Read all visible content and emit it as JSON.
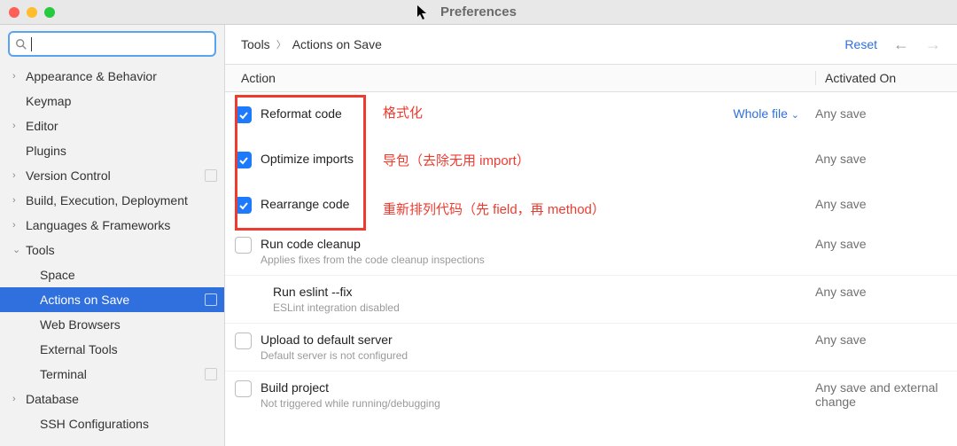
{
  "window": {
    "title": "Preferences"
  },
  "search": {
    "placeholder": ""
  },
  "sidebar": {
    "items": [
      {
        "label": "Appearance & Behavior",
        "expandable": true
      },
      {
        "label": "Keymap"
      },
      {
        "label": "Editor",
        "expandable": true
      },
      {
        "label": "Plugins"
      },
      {
        "label": "Version Control",
        "expandable": true,
        "badge": true
      },
      {
        "label": "Build, Execution, Deployment",
        "expandable": true
      },
      {
        "label": "Languages & Frameworks",
        "expandable": true
      },
      {
        "label": "Tools",
        "expandable": true,
        "open": true,
        "children": [
          {
            "label": "Space"
          },
          {
            "label": "Actions on Save",
            "selected": true,
            "badge": true
          },
          {
            "label": "Web Browsers"
          },
          {
            "label": "External Tools"
          },
          {
            "label": "Terminal",
            "badge": true
          }
        ]
      },
      {
        "label": "Database",
        "expandable": true
      },
      {
        "label": "SSH Configurations",
        "child": true
      }
    ]
  },
  "breadcrumb": {
    "parent": "Tools",
    "current": "Actions on Save"
  },
  "topbar": {
    "reset": "Reset"
  },
  "table": {
    "headers": {
      "action": "Action",
      "activated": "Activated On"
    }
  },
  "actions": [
    {
      "checked": true,
      "label": "Reformat code",
      "scope": "Whole file",
      "activated": "Any save"
    },
    {
      "checked": true,
      "label": "Optimize imports",
      "activated": "Any save"
    },
    {
      "checked": true,
      "label": "Rearrange code",
      "activated": "Any save"
    },
    {
      "checked": false,
      "label": "Run code cleanup",
      "sub": "Applies fixes from the code cleanup inspections",
      "activated": "Any save"
    },
    {
      "checked": false,
      "label": "Run eslint --fix",
      "sub": "ESLint integration disabled",
      "indent": true,
      "activated": "Any save"
    },
    {
      "checked": false,
      "label": "Upload to default server",
      "sub": "Default server is not configured",
      "activated": "Any save"
    },
    {
      "checked": false,
      "label": "Build project",
      "sub": "Not triggered while running/debugging",
      "activated": "Any save and external change"
    }
  ],
  "annotations": [
    {
      "text": "格式化"
    },
    {
      "text": "导包（去除无用 import）"
    },
    {
      "text": "重新排列代码（先 field，再 method）"
    }
  ]
}
